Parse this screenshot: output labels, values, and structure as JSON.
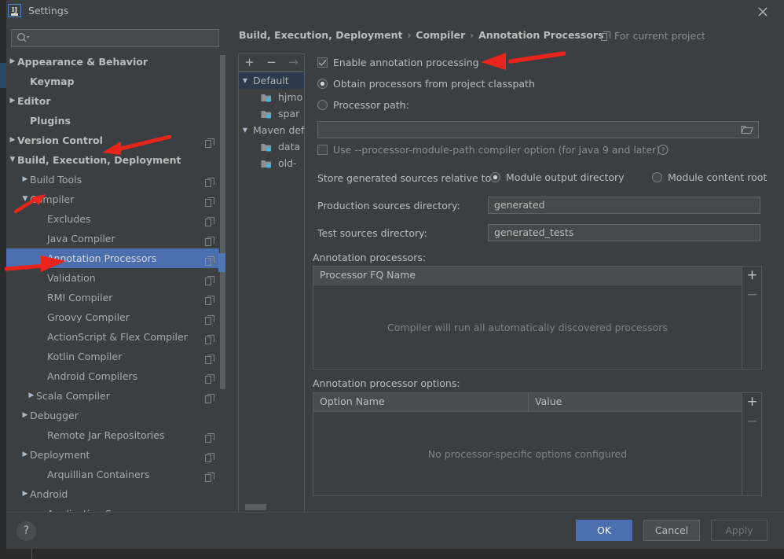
{
  "window": {
    "title": "Settings",
    "logo_text": "IJ",
    "close_icon": "close-icon"
  },
  "search": {
    "value": "",
    "placeholder": "",
    "icon": "search-icon"
  },
  "sidebar": {
    "items": [
      {
        "label": "Appearance & Behavior",
        "arrow": "▶",
        "indent": 14,
        "bold": true,
        "badge": false,
        "selected": false
      },
      {
        "label": "Keymap",
        "arrow": "",
        "indent": 30,
        "bold": true,
        "badge": false,
        "selected": false
      },
      {
        "label": "Editor",
        "arrow": "▶",
        "indent": 14,
        "bold": true,
        "badge": false,
        "selected": false
      },
      {
        "label": "Plugins",
        "arrow": "",
        "indent": 30,
        "bold": true,
        "badge": false,
        "selected": false
      },
      {
        "label": "Version Control",
        "arrow": "▶",
        "indent": 14,
        "bold": true,
        "badge": true,
        "selected": false
      },
      {
        "label": "Build, Execution, Deployment",
        "arrow": "▼",
        "indent": 14,
        "bold": true,
        "badge": false,
        "selected": false
      },
      {
        "label": "Build Tools",
        "arrow": "▶",
        "indent": 30,
        "bold": false,
        "badge": true,
        "selected": false
      },
      {
        "label": "Compiler",
        "arrow": "▼",
        "indent": 30,
        "bold": false,
        "badge": true,
        "selected": false
      },
      {
        "label": "Excludes",
        "arrow": "",
        "indent": 52,
        "bold": false,
        "badge": true,
        "selected": false
      },
      {
        "label": "Java Compiler",
        "arrow": "",
        "indent": 52,
        "bold": false,
        "badge": true,
        "selected": false
      },
      {
        "label": "Annotation Processors",
        "arrow": "",
        "indent": 52,
        "bold": false,
        "badge": true,
        "selected": true
      },
      {
        "label": "Validation",
        "arrow": "",
        "indent": 52,
        "bold": false,
        "badge": true,
        "selected": false
      },
      {
        "label": "RMI Compiler",
        "arrow": "",
        "indent": 52,
        "bold": false,
        "badge": true,
        "selected": false
      },
      {
        "label": "Groovy Compiler",
        "arrow": "",
        "indent": 52,
        "bold": false,
        "badge": true,
        "selected": false
      },
      {
        "label": "ActionScript & Flex Compiler",
        "arrow": "",
        "indent": 52,
        "bold": false,
        "badge": true,
        "selected": false
      },
      {
        "label": "Kotlin Compiler",
        "arrow": "",
        "indent": 52,
        "bold": false,
        "badge": true,
        "selected": false
      },
      {
        "label": "Android Compilers",
        "arrow": "",
        "indent": 52,
        "bold": false,
        "badge": true,
        "selected": false
      },
      {
        "label": "Scala Compiler",
        "arrow": "▶",
        "indent": 38,
        "bold": false,
        "badge": true,
        "selected": false
      },
      {
        "label": "Debugger",
        "arrow": "▶",
        "indent": 30,
        "bold": false,
        "badge": false,
        "selected": false
      },
      {
        "label": "Remote Jar Repositories",
        "arrow": "",
        "indent": 52,
        "bold": false,
        "badge": true,
        "selected": false
      },
      {
        "label": "Deployment",
        "arrow": "▶",
        "indent": 30,
        "bold": false,
        "badge": true,
        "selected": false
      },
      {
        "label": "Arquillian Containers",
        "arrow": "",
        "indent": 52,
        "bold": false,
        "badge": true,
        "selected": false
      },
      {
        "label": "Android",
        "arrow": "▶",
        "indent": 30,
        "bold": false,
        "badge": false,
        "selected": false
      },
      {
        "label": "Application S",
        "arrow": "",
        "indent": 52,
        "bold": false,
        "badge": false,
        "selected": false
      }
    ]
  },
  "breadcrumb": {
    "items": [
      "Build, Execution, Deployment",
      "Compiler",
      "Annotation Processors"
    ],
    "separator": "›",
    "scope_label": "For current project",
    "scope_icon": "project-scope-icon"
  },
  "profile_toolbar": {
    "add_label": "+",
    "remove_label": "−",
    "move_label": "→"
  },
  "profile_list": {
    "rows": [
      {
        "label": "Default",
        "type": "group",
        "arrow": "▼",
        "indent": 18,
        "selected": true
      },
      {
        "label": "hjmo",
        "type": "module",
        "arrow": "",
        "indent": 50,
        "selected": false
      },
      {
        "label": "spar",
        "type": "module",
        "arrow": "",
        "indent": 50,
        "selected": false
      },
      {
        "label": "Maven def",
        "type": "group",
        "arrow": "▼",
        "indent": 18,
        "selected": false
      },
      {
        "label": "data",
        "type": "module",
        "arrow": "",
        "indent": 50,
        "selected": false
      },
      {
        "label": "old-",
        "type": "module",
        "arrow": "",
        "indent": 50,
        "selected": false
      }
    ]
  },
  "settings": {
    "enable_annotation_processing": {
      "label": "Enable annotation processing",
      "checked": true
    },
    "source_mode": {
      "options": [
        {
          "label": "Obtain processors from project classpath",
          "selected": true
        },
        {
          "label": "Processor path:",
          "selected": false
        }
      ]
    },
    "processor_path": {
      "value": "",
      "browse_icon": "folder-browse-icon"
    },
    "module_path_option": {
      "label": "Use --processor-module-path compiler option (for Java 9 and later)",
      "checked": false,
      "help_icon": "help-circle-icon"
    },
    "store_relative_to": {
      "label": "Store generated sources relative to:",
      "options": [
        {
          "label": "Module output directory",
          "selected": true
        },
        {
          "label": "Module content root",
          "selected": false
        }
      ]
    },
    "production_sources": {
      "label": "Production sources directory:",
      "value": "generated"
    },
    "test_sources": {
      "label": "Test sources directory:",
      "value": "generated_tests"
    },
    "processors_table": {
      "title": "Annotation processors:",
      "columns": [
        "Processor FQ Name"
      ],
      "rows": [],
      "empty_text": "Compiler will run all automatically discovered processors",
      "add_label": "+",
      "remove_label": "−"
    },
    "options_table": {
      "title": "Annotation processor options:",
      "columns": [
        "Option Name",
        "Value"
      ],
      "rows": [],
      "empty_text": "No processor-specific options configured",
      "add_label": "+",
      "remove_label": "−"
    }
  },
  "footer": {
    "help_label": "?",
    "ok_label": "OK",
    "cancel_label": "Cancel",
    "apply_label": "Apply"
  },
  "colors": {
    "dialog_bg": "#3c3f41",
    "selection_blue": "#4b6eaf",
    "profile_selection": "#2d3a4c",
    "field_bg": "#45494a",
    "text": "#bbbbbb",
    "annotation_red": "#e8241c"
  }
}
